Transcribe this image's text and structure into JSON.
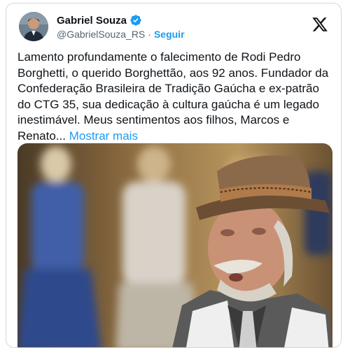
{
  "author": {
    "name": "Gabriel Souza",
    "handle": "@GabrielSouza_RS",
    "separator": "·",
    "follow_label": "Seguir",
    "verified": true
  },
  "tweet": {
    "text": "Lamento profundamente o falecimento de Rodi Pedro Borghetti, o querido Borghettão, aos 92 anos. Fundador da Confederação Brasileira de Tradição Gaúcha e ex-patrão do CTG 35, sua dedicação à cultura gaúcha é um legado inestimável. Meus sentimentos aos filhos, Marcos e Renato...",
    "show_more_label": "Mostrar mais"
  },
  "icons": {
    "verified": "verified-badge-icon",
    "platform": "x-logo-icon"
  },
  "colors": {
    "accent": "#1d9bf0",
    "text": "#0f1419",
    "secondary": "#536471",
    "border": "#cfd9de"
  }
}
